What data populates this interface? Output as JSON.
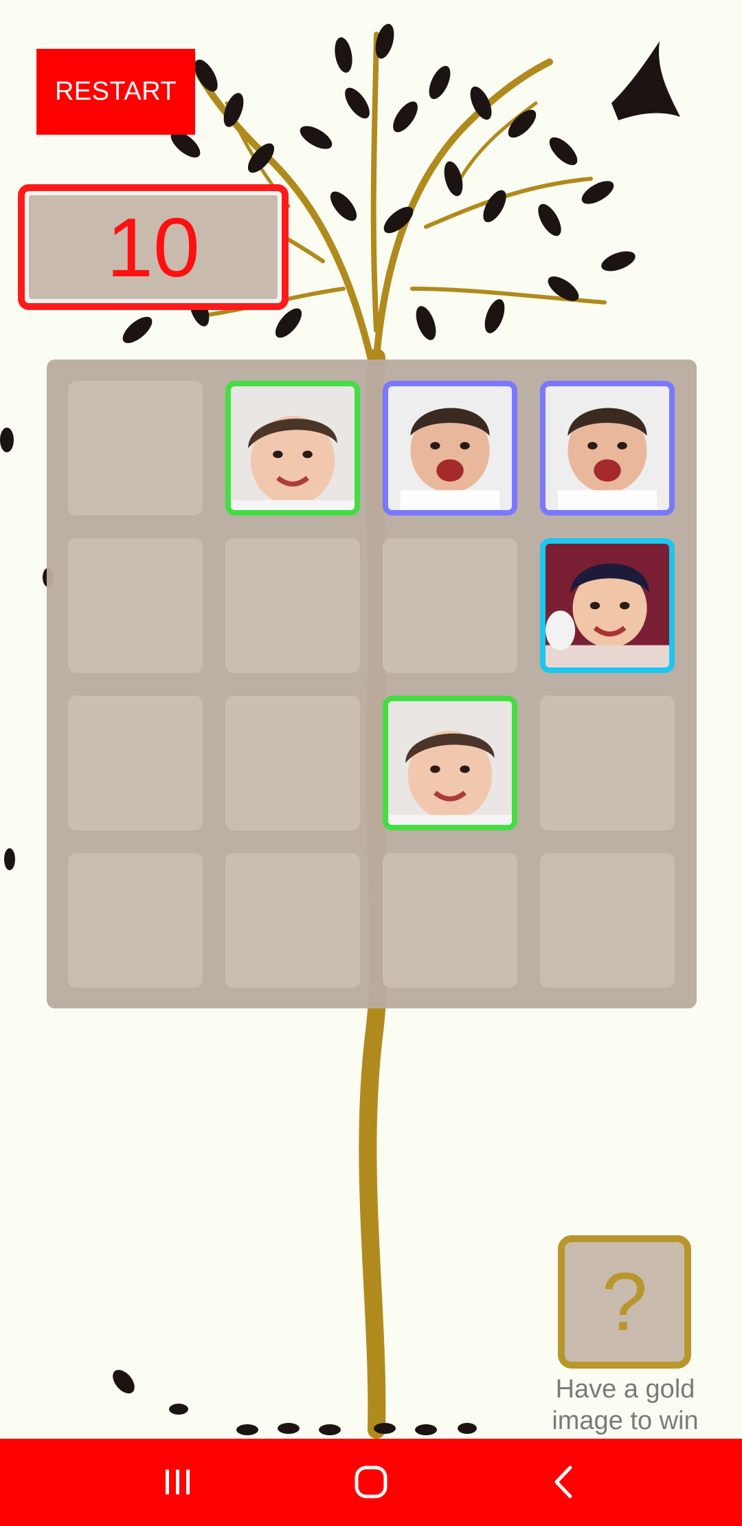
{
  "game": {
    "restart_label": "RESTART",
    "score": "10"
  },
  "board": {
    "rows": 4,
    "cols": 4,
    "tiles": [
      {
        "row": 0,
        "col": 1,
        "frame": "green",
        "child": "toddler-girl-smiling"
      },
      {
        "row": 0,
        "col": 2,
        "frame": "blue",
        "child": "toddler-boy-laughing"
      },
      {
        "row": 0,
        "col": 3,
        "frame": "blue",
        "child": "toddler-boy-laughing"
      },
      {
        "row": 1,
        "col": 3,
        "frame": "cyan",
        "child": "boy-smiling"
      },
      {
        "row": 2,
        "col": 2,
        "frame": "green",
        "child": "toddler-girl-smiling"
      }
    ]
  },
  "help": {
    "icon_text": "?",
    "hint_line1": "Have a gold",
    "hint_line2": "image to win"
  },
  "colors": {
    "accent": "#ff0000",
    "gold": "#b8962c",
    "frame_green": "#44dd44",
    "frame_blue": "#7a78ff",
    "frame_cyan": "#1cc6ee"
  },
  "navbar": {
    "icons": [
      "recent-apps-icon",
      "home-icon",
      "back-icon"
    ]
  }
}
